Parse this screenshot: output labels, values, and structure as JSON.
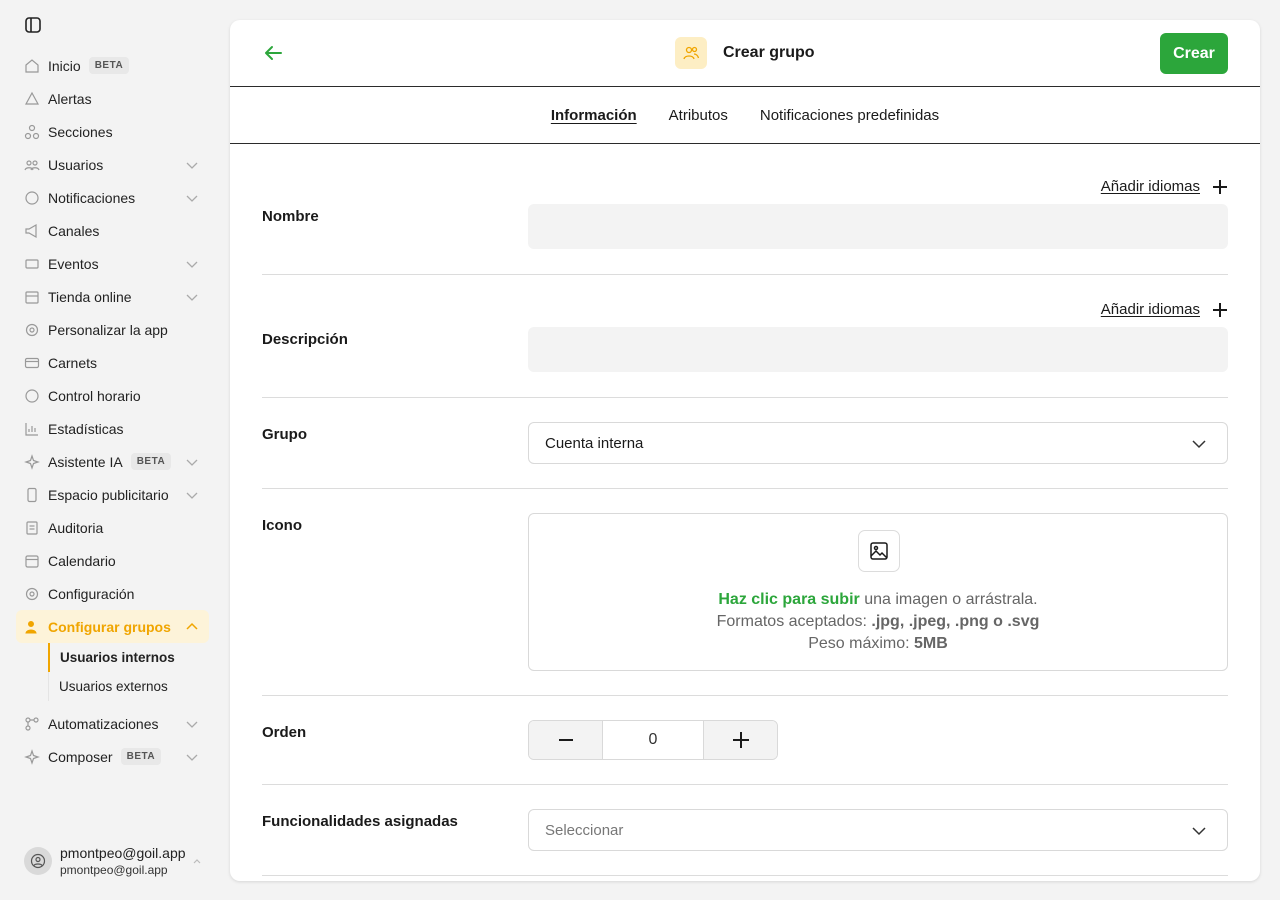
{
  "sidebar": {
    "items": [
      {
        "label": "Inicio",
        "badge": "BETA",
        "icon": "home-icon"
      },
      {
        "label": "Alertas",
        "icon": "alert-icon"
      },
      {
        "label": "Secciones",
        "icon": "sections-icon"
      },
      {
        "label": "Usuarios",
        "icon": "users-icon",
        "expandable": true
      },
      {
        "label": "Notificaciones",
        "icon": "chat-icon",
        "expandable": true
      },
      {
        "label": "Canales",
        "icon": "megaphone-icon"
      },
      {
        "label": "Eventos",
        "icon": "ticket-icon",
        "expandable": true
      },
      {
        "label": "Tienda online",
        "icon": "store-icon",
        "expandable": true
      },
      {
        "label": "Personalizar la app",
        "icon": "gear-icon"
      },
      {
        "label": "Carnets",
        "icon": "card-icon"
      },
      {
        "label": "Control horario",
        "icon": "clock-icon"
      },
      {
        "label": "Estadísticas",
        "icon": "chart-icon"
      },
      {
        "label": "Asistente IA",
        "badge": "BETA",
        "icon": "sparkle-icon",
        "expandable": true
      },
      {
        "label": "Espacio publicitario",
        "icon": "phone-icon",
        "expandable": true
      },
      {
        "label": "Auditoria",
        "icon": "document-icon"
      },
      {
        "label": "Calendario",
        "icon": "calendar-icon"
      },
      {
        "label": "Configuración",
        "icon": "settings-icon"
      },
      {
        "label": "Configurar grupos",
        "icon": "group-icon",
        "active": true
      },
      {
        "label": "Automatizaciones",
        "icon": "flow-icon",
        "expandable": true
      },
      {
        "label": "Composer",
        "badge": "BETA",
        "icon": "sparkle-icon",
        "expandable": true
      }
    ],
    "subitems": [
      {
        "label": "Usuarios internos",
        "active": true
      },
      {
        "label": "Usuarios externos"
      }
    ],
    "user": {
      "name": "pmontpeo@goil.app",
      "email": "pmontpeo@goil.app"
    }
  },
  "header": {
    "title": "Crear grupo",
    "create_label": "Crear"
  },
  "tabs": [
    {
      "label": "Información",
      "active": true
    },
    {
      "label": "Atributos"
    },
    {
      "label": "Notificaciones predefinidas"
    }
  ],
  "form": {
    "add_languages": "Añadir idiomas",
    "name_label": "Nombre",
    "name_value": "",
    "description_label": "Descripción",
    "description_value": "",
    "group_label": "Grupo",
    "group_value": "Cuenta interna",
    "icon_label": "Icono",
    "upload_click": "Haz clic para subir",
    "upload_rest": " una imagen o arrástrala.",
    "formats_prefix": "Formatos aceptados: ",
    "formats": ".jpg, .jpeg, .png o .svg",
    "weight_prefix": "Peso máximo: ",
    "weight": "5MB",
    "order_label": "Orden",
    "order_value": "0",
    "features_label": "Funcionalidades asignadas",
    "features_placeholder": "Seleccionar"
  },
  "colors": {
    "accent": "#2ca63b",
    "active_nav": "#f0a500",
    "active_nav_bg": "#fdf3d9"
  }
}
